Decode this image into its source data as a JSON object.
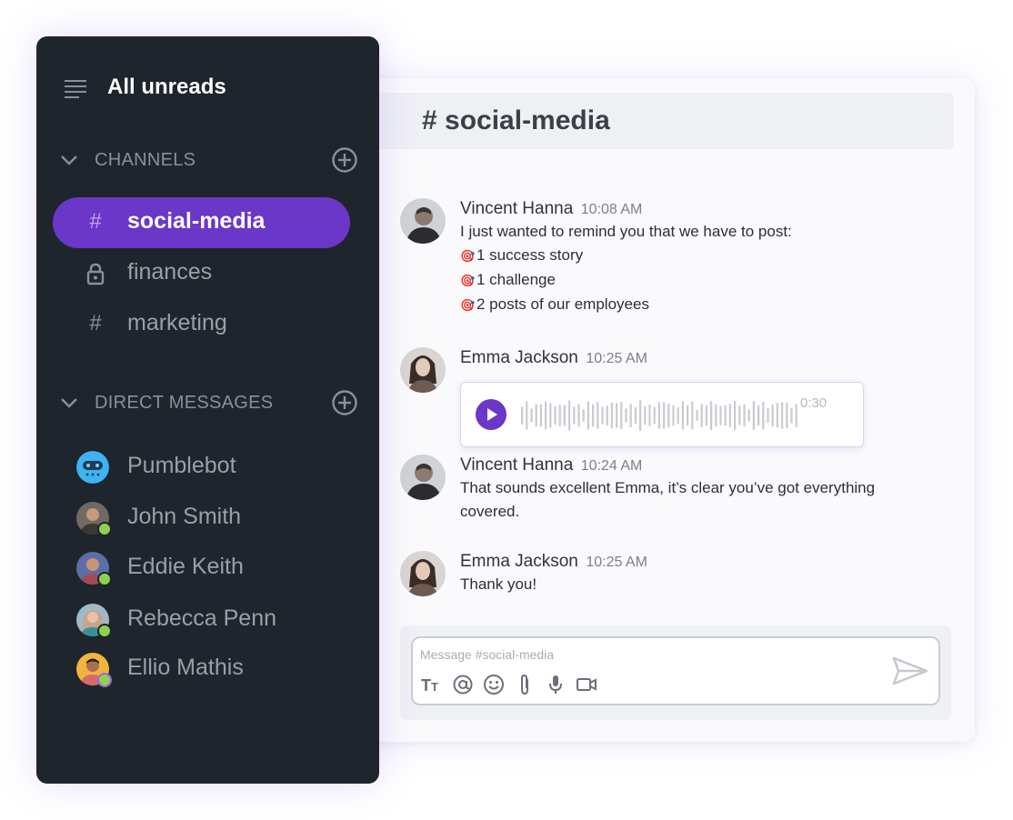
{
  "sidebar": {
    "title": "All unreads",
    "channels_label": "CHANNELS",
    "dm_label": "DIRECT MESSAGES",
    "channels": [
      {
        "icon": "hash-icon",
        "label": "social-media",
        "active": true
      },
      {
        "icon": "lock-icon",
        "label": "finances",
        "active": false
      },
      {
        "icon": "hash-icon",
        "label": "marketing",
        "active": false
      }
    ],
    "direct_messages": [
      {
        "label": "Pumblebot",
        "avatar": "bot-avatar",
        "online": false
      },
      {
        "label": "John Smith",
        "avatar": "user-avatar",
        "online": true
      },
      {
        "label": "Eddie Keith",
        "avatar": "user-avatar",
        "online": true
      },
      {
        "label": "Rebecca Penn",
        "avatar": "user-avatar",
        "online": true
      },
      {
        "label": "Ellio Mathis",
        "avatar": "user-avatar",
        "online": true
      }
    ]
  },
  "chat": {
    "title": "# social-media",
    "messages": [
      {
        "author": "Vincent Hanna",
        "time": "10:08 AM",
        "lines": [
          {
            "text": "I just wanted to remind you that we have to post:",
            "icon": ""
          },
          {
            "text": "1 success story",
            "icon": "🎯"
          },
          {
            "text": "1 challenge",
            "icon": "🎯"
          },
          {
            "text": "2  posts of our employees",
            "icon": "🎯"
          }
        ]
      },
      {
        "author": "Emma Jackson",
        "time": "10:25 AM",
        "voice_duration": "0:30"
      },
      {
        "author": "Vincent Hanna",
        "time": "10:24 AM",
        "lines": [
          {
            "text": "That sounds excellent Emma, it’s clear you’ve got everything",
            "icon": ""
          },
          {
            "text": "covered.",
            "icon": ""
          }
        ]
      },
      {
        "author": "Emma Jackson",
        "time": "10:25 AM",
        "lines": [
          {
            "text": "Thank you!",
            "icon": ""
          }
        ]
      }
    ],
    "composer": {
      "placeholder": "Message #social-media",
      "tools": [
        "text-format-icon",
        "mention-icon",
        "emoji-icon",
        "attach-icon",
        "microphone-icon",
        "video-icon"
      ],
      "send_icon": "send-icon"
    }
  },
  "colors": {
    "sidebar_bg": "#1f252c",
    "accent": "#6a37c8",
    "online": "#8fd14f",
    "bot": "#3db4f2"
  }
}
